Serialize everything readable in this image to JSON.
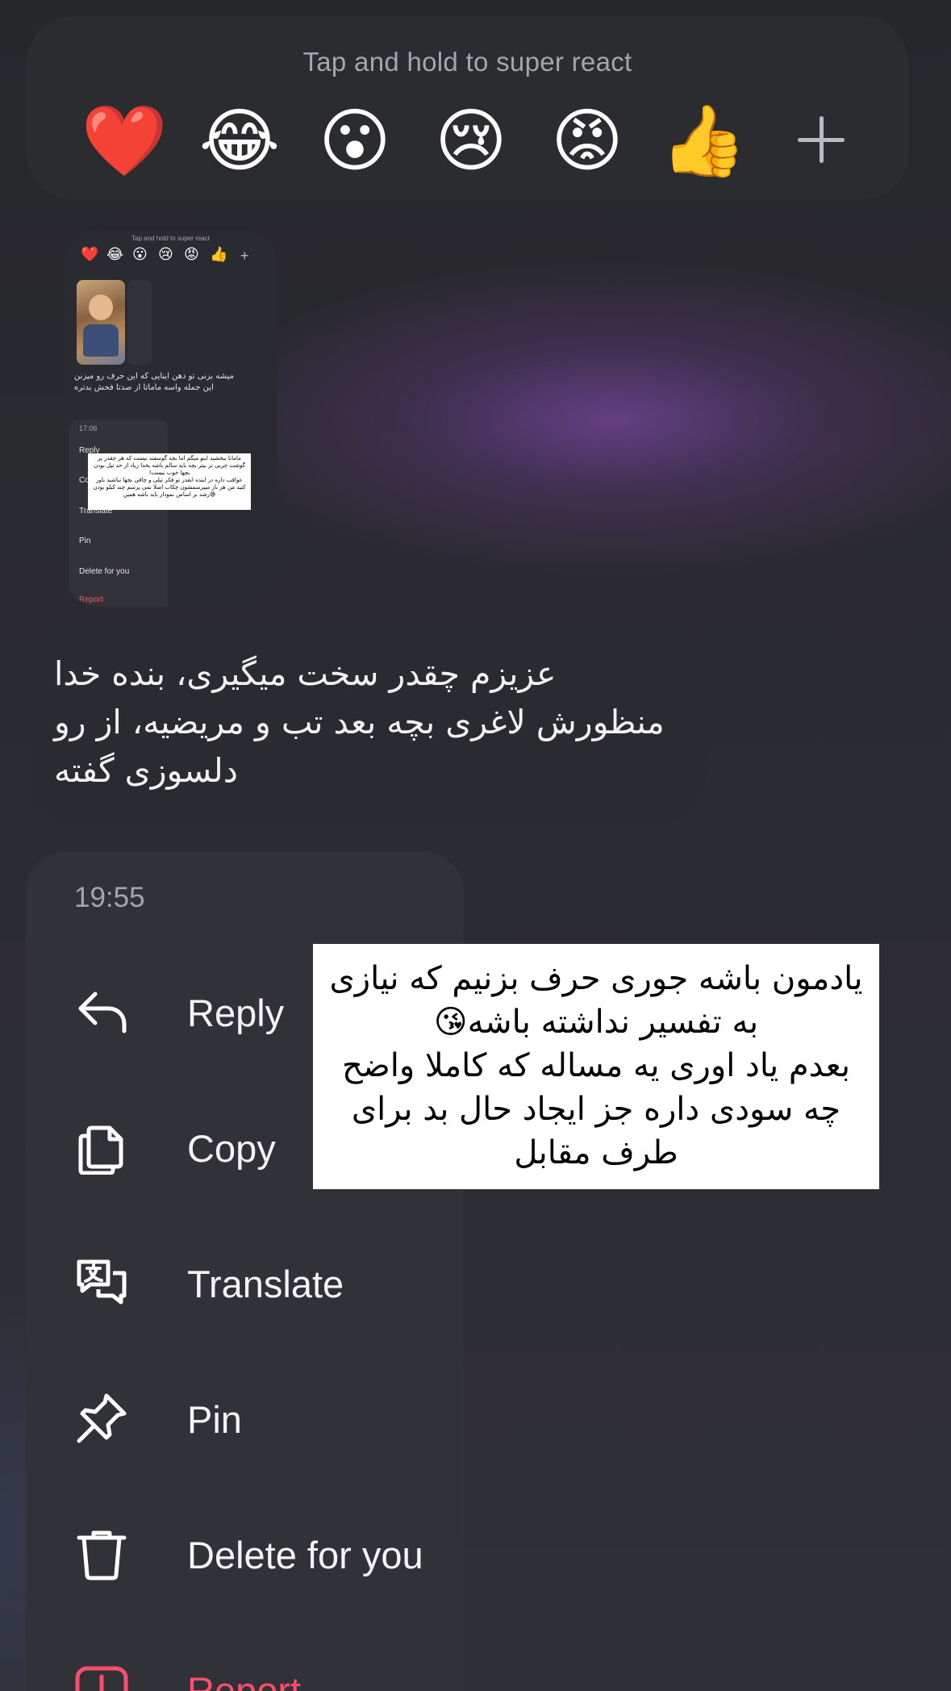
{
  "reactions": {
    "hint": "Tap and hold to super react",
    "emojis": [
      "❤️",
      "😂",
      "😮",
      "😢",
      "😡",
      "👍"
    ],
    "add_icon": "plus-icon"
  },
  "thumbnail": {
    "hint": "Tap and hold to super react",
    "text": "میشه بزنی تو دهن اینایی که این حرف رو میزنن\nاین جمله واسه ماماتا از صدتا فحش بدتره",
    "time": "17:06",
    "items": [
      "Reply",
      "Copy",
      "Translate",
      "Pin",
      "Delete for you",
      "Report"
    ],
    "overlay_text": "مامانا ببخشید اینو میگم اما بچه گوسفند نیست که هر چقدر پر گوشت چربی تر بیتر بچه باید سالم باشه بخدا زیاد از حد تپل بودن بچها خوب نیست!\nعواقب داره در اینده انقدر تو فکر تپلی و چاقی بچها نباشید باور کنید من هر بار میپرسمشون چکاب اصلا نمی پرسم چند کیلو بودن 😅رشد بر اساس نمودار باید باشه همین"
  },
  "message": {
    "text": "عزیزم چقدر سخت میگیری، بنده خدا منظورش لاغری بچه بعد تب و مریضیه، از رو دلسوزی گفته"
  },
  "menu": {
    "time": "19:55",
    "items": [
      {
        "label": "Reply",
        "icon": "reply-icon"
      },
      {
        "label": "Copy",
        "icon": "copy-icon"
      },
      {
        "label": "Translate",
        "icon": "translate-icon"
      },
      {
        "label": "Pin",
        "icon": "pin-icon"
      },
      {
        "label": "Delete for you",
        "icon": "trash-icon"
      },
      {
        "label": "Report",
        "icon": "report-icon",
        "color": "#ff4d6d"
      }
    ]
  },
  "sticker": {
    "text": "یادمون باشه جوری حرف بزنیم که نیازی به تفسیر نداشته باشه😘\nبعدم یاد اوری یه مساله که کاملا واضح چه سودی داره جز ایجاد حال بد برای طرف مقابل"
  }
}
